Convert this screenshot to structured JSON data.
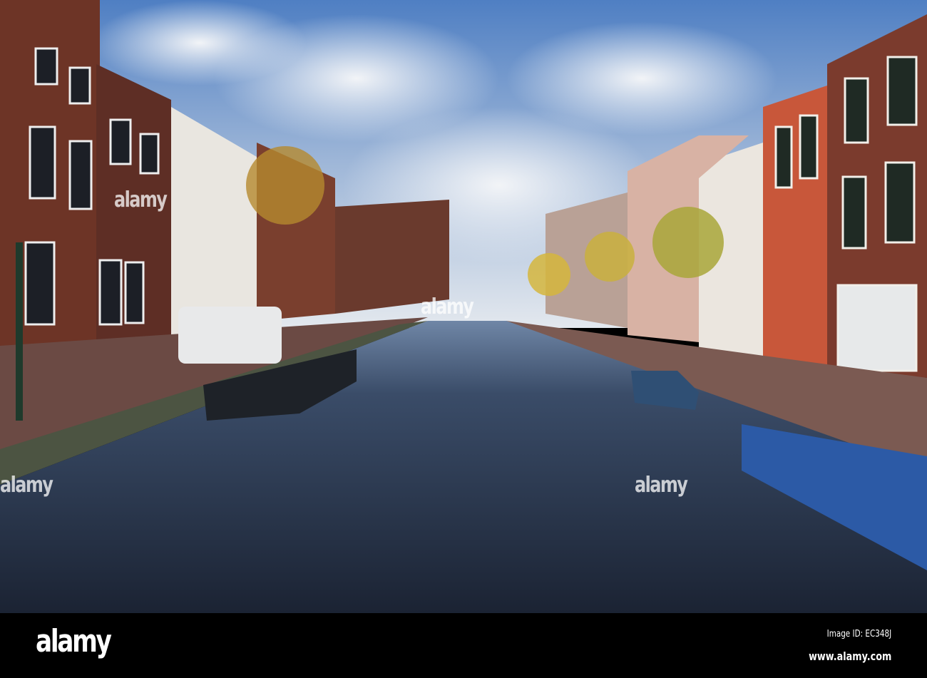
{
  "photo": {
    "subject": "canal",
    "colors": {
      "sky": "#5b86c4",
      "cloud": "#e6ebf1",
      "water": "#1f2a3c",
      "brick": "#7a3b2c",
      "quay": "#6e4a3f",
      "boat_blue": "#2c5aa6"
    }
  },
  "watermark": {
    "text": "alamy"
  },
  "footer": {
    "logo": "alamy",
    "image_id": "Image ID: EC348J",
    "url": "www.alamy.com"
  }
}
